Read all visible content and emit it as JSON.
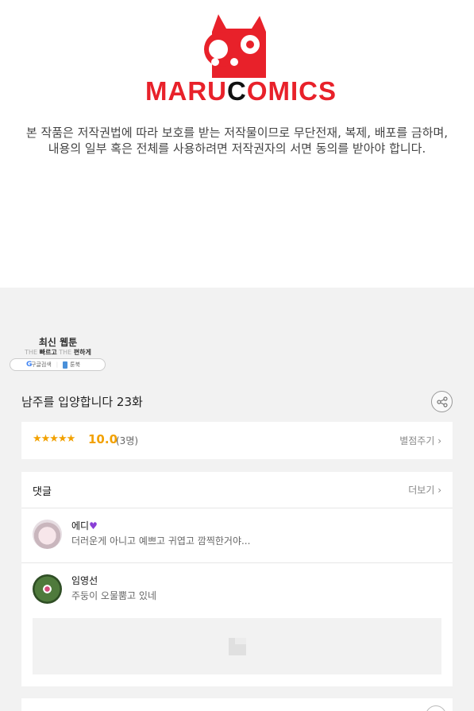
{
  "header": {
    "logo": {
      "left": "MARU",
      "middle": "C",
      "right": "OMICS",
      "brand_color": "#e8212a"
    },
    "copyright_lines": [
      "본 작품은 저작권법에 따라 보호를 받는 저작물이므로 무단전재, 복제, 배포를 금하며,",
      "내용의 일부 혹은 전체를 사용하려면 저작권자의 서면 동의를 받아야 합니다."
    ]
  },
  "badge": {
    "title": "최신 웹툰",
    "sub_pale_1": "THE",
    "sub_1": "빠르고",
    "sub_pale_2": "THE",
    "sub_2": "편하게",
    "google_g": "G",
    "search_label": "구글검색",
    "brand_label": "툰북"
  },
  "episode": {
    "title": "남주를 입양합니다 23화"
  },
  "rating": {
    "stars": "★★★★★",
    "score": "10.0",
    "count": "(3명)",
    "rate_link": "별점주기 ›",
    "star_color": "#f2a100"
  },
  "comments": {
    "title": "댓글",
    "more": "더보기 ›",
    "items": [
      {
        "author": "에디",
        "badge": "♥",
        "text": "더러운게 아니고 예쁘고 귀엽고 깜찍한거야..."
      },
      {
        "author": "임영선",
        "text": "주둥이 오물뿜고 있네"
      }
    ]
  },
  "icons": [
    "owl-logo-icon",
    "share-icon",
    "star-icon",
    "heart-icon",
    "image-placeholder-icon",
    "book-icon"
  ]
}
